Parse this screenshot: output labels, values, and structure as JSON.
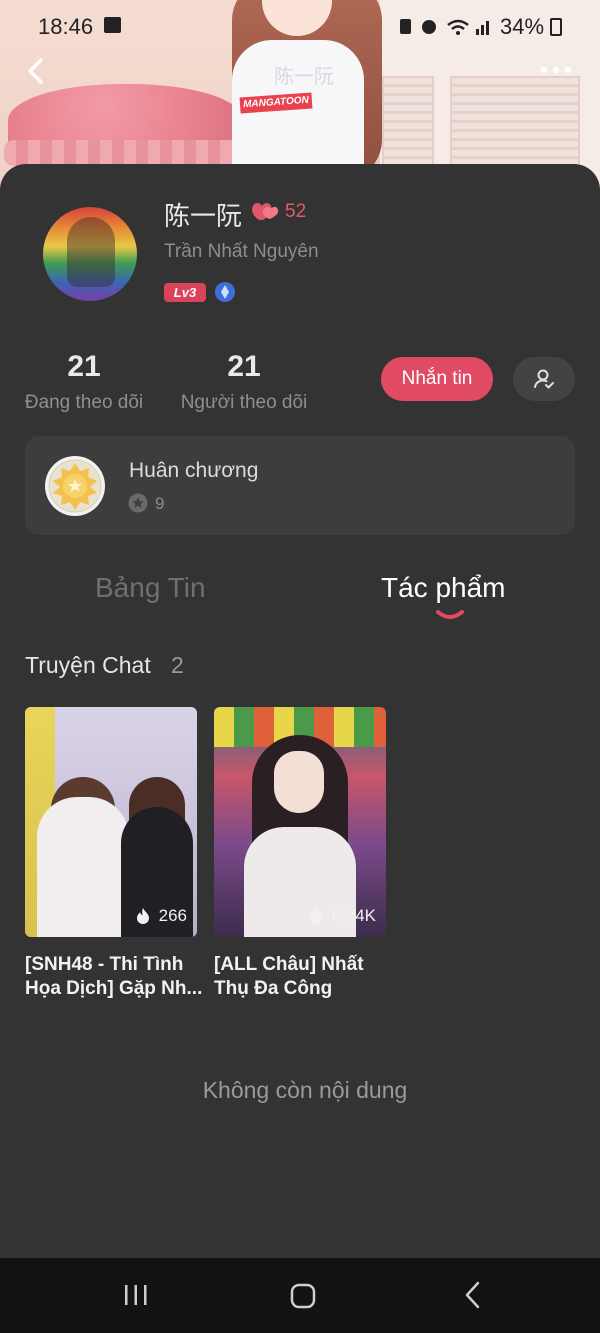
{
  "status_bar": {
    "time": "18:46",
    "battery": "34%"
  },
  "banner": {
    "shirt_brand": "MANGATOON",
    "shirt_text": "陈一阮"
  },
  "profile": {
    "name": "陈一阮",
    "subname": "Trần Nhất Nguyên",
    "hearts": "52",
    "level": "Lv3"
  },
  "stats": [
    {
      "value": "21",
      "label": "Đang theo dõi"
    },
    {
      "value": "21",
      "label": "Người theo dõi"
    }
  ],
  "actions": {
    "message_label": "Nhắn tin"
  },
  "medal": {
    "title": "Huân chương",
    "count": "9"
  },
  "tabs": [
    {
      "label": "Bảng Tin",
      "active": false
    },
    {
      "label": "Tác phẩm",
      "active": true
    }
  ],
  "section": {
    "title": "Truyện Chat",
    "count": "2"
  },
  "works": [
    {
      "title": "[SNH48 - Thi Tình Họa Dịch] Gặp Nh...",
      "views": "266"
    },
    {
      "title": "[ALL Châu] Nhất Thụ Đa Công",
      "views": "6.24K"
    }
  ],
  "end_text": "Không còn nội dung",
  "colors": {
    "accent": "#e04a63",
    "background": "#333333",
    "card": "#3d3d3d",
    "navbar": "#121212"
  },
  "icons": [
    "back-icon",
    "more-icon",
    "heart-icon",
    "vip-icon",
    "follow-user-icon",
    "medal-icon",
    "star-icon",
    "fire-icon",
    "recent-apps-icon",
    "home-icon",
    "nav-back-icon"
  ]
}
